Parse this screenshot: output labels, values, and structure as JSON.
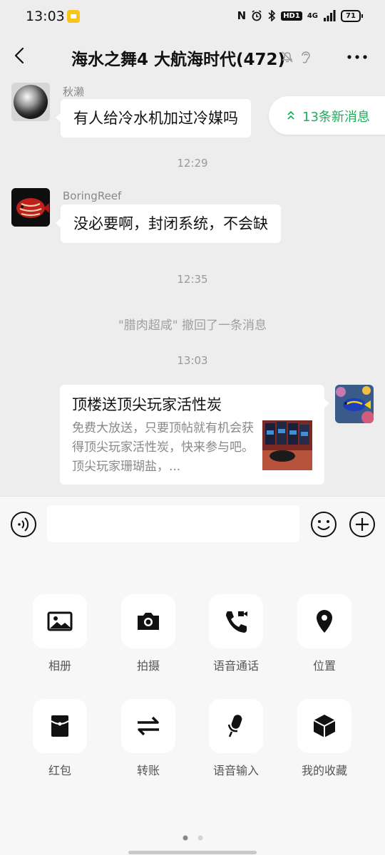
{
  "status_bar": {
    "time": "13:03",
    "network": "4G",
    "hd_label": "HD1",
    "battery": "71"
  },
  "header": {
    "title": "海水之舞4 大航海时代(472)"
  },
  "messages": [
    {
      "sender": "秋濑",
      "text": "有人给冷水机加过冷媒吗"
    },
    {
      "sender": "BoringReef",
      "text": "没必要啊，封闭系统，不会缺"
    }
  ],
  "timestamps": [
    "12:29",
    "12:35",
    "13:03"
  ],
  "recall_notice": "\"腊肉超咸\" 撤回了一条消息",
  "new_messages_badge": "13条新消息",
  "shared_card": {
    "title": "顶楼送顶尖玩家活性炭",
    "description": "免费大放送，只要顶帖就有机会获得顶尖玩家活性炭，快来参与吧。顶尖玩家珊瑚盐，..."
  },
  "input": {
    "placeholder": ""
  },
  "panel": {
    "items": [
      {
        "label": "相册",
        "icon": "photo-album-icon"
      },
      {
        "label": "拍摄",
        "icon": "camera-icon"
      },
      {
        "label": "语音通话",
        "icon": "phone-call-icon"
      },
      {
        "label": "位置",
        "icon": "location-pin-icon"
      },
      {
        "label": "红包",
        "icon": "red-packet-icon"
      },
      {
        "label": "转账",
        "icon": "transfer-icon"
      },
      {
        "label": "语音输入",
        "icon": "microphone-icon"
      },
      {
        "label": "我的收藏",
        "icon": "favorites-cube-icon"
      }
    ]
  },
  "colors": {
    "accent_green": "#1FAD5B",
    "chat_background": "#EDEDED",
    "panel_background": "#F7F7F7"
  }
}
